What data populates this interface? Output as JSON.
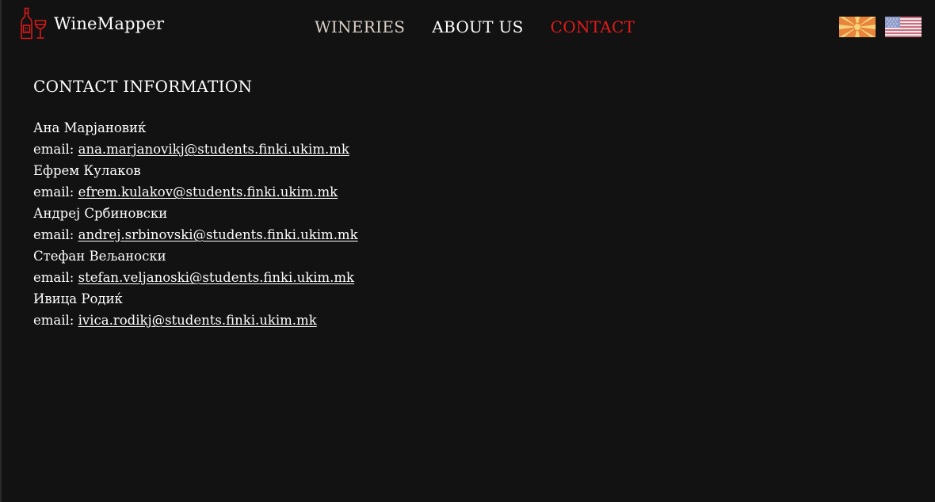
{
  "header": {
    "brand_name": "WineMapper",
    "logo_icon": "wine-bottle-glass-icon",
    "nav": [
      {
        "label": "WINERIES",
        "color": "#d8cfc7"
      },
      {
        "label": "ABOUT US",
        "color": "#ffffff"
      },
      {
        "label": "CONTACT",
        "color": "#e01b1b",
        "active": true
      }
    ],
    "languages": [
      {
        "icon": "macedonia-flag-icon"
      },
      {
        "icon": "usa-flag-icon"
      }
    ]
  },
  "main": {
    "title": "CONTACT INFORMATION",
    "email_prefix": "email: ",
    "contacts": [
      {
        "name": "Ана Марјановиќ",
        "email": "ana.marjanovikj@students.finki.ukim.mk"
      },
      {
        "name": "Ефрем Кулаков",
        "email": "efrem.kulakov@students.finki.ukim.mk"
      },
      {
        "name": "Андреј Србиновски",
        "email": "andrej.srbinovski@students.finki.ukim.mk"
      },
      {
        "name": "Стефан Вељаноски",
        "email": "stefan.veljanoski@students.finki.ukim.mk"
      },
      {
        "name": "Ивица Родиќ",
        "email": "ivica.rodikj@students.finki.ukim.mk"
      }
    ]
  },
  "colors": {
    "background": "#121212",
    "accent": "#e01b1b",
    "text": "#ffffff"
  }
}
